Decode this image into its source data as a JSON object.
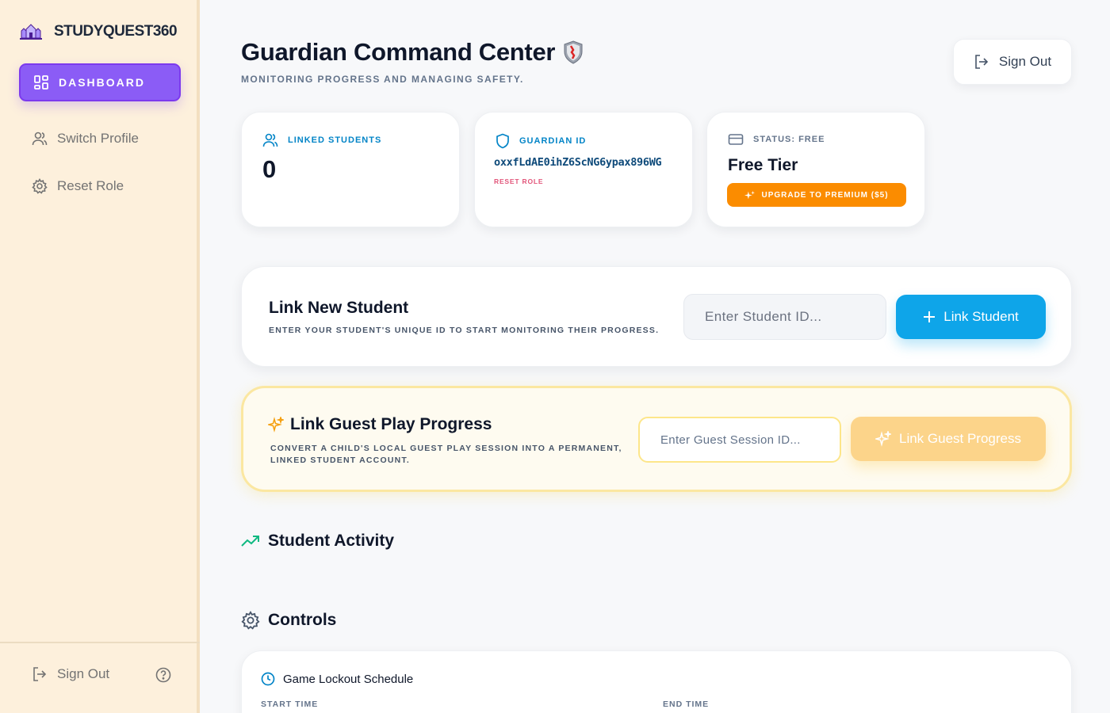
{
  "colors": {
    "accent_purple": "#8b5cf6",
    "accent_blue": "#0ea5e9",
    "accent_orange": "#fb8c00",
    "sidebar_bg": "#fdf0dc",
    "danger_pink": "#e2557a"
  },
  "sidebar": {
    "brand": "STUDYQUEST360",
    "items": [
      {
        "label": "DASHBOARD",
        "icon": "dashboard-grid-icon",
        "active": true
      },
      {
        "label": "Switch Profile",
        "icon": "users-icon"
      },
      {
        "label": "Reset Role",
        "icon": "gear-icon"
      }
    ],
    "signout_label": "Sign Out",
    "help_icon": "help-circle-icon"
  },
  "header": {
    "title": "Guardian Command Center",
    "title_icon": "shield-emoji-icon",
    "subtitle": "MONITORING PROGRESS AND MANAGING SAFETY.",
    "signout_label": "Sign Out"
  },
  "stats": {
    "linked": {
      "label": "LINKED STUDENTS",
      "value": "0"
    },
    "guardian": {
      "label": "GUARDIAN ID",
      "id": "oxxfLdAE0ihZ6ScNG6ypax896WG",
      "reset_label": "RESET ROLE"
    },
    "status": {
      "label": "STATUS: FREE",
      "tier": "Free Tier",
      "upgrade_label": "UPGRADE TO PREMIUM ($5)"
    }
  },
  "link_student": {
    "title": "Link New Student",
    "description": "ENTER YOUR STUDENT'S UNIQUE ID TO START MONITORING THEIR PROGRESS.",
    "placeholder": "Enter Student ID...",
    "button_label": "Link Student"
  },
  "guest": {
    "title": "Link Guest Play Progress",
    "description_line1": "CONVERT A CHILD'S LOCAL GUEST PLAY SESSION INTO A PERMANENT,",
    "description_line2": "LINKED STUDENT ACCOUNT.",
    "placeholder": "Enter Guest Session ID...",
    "button_label": "Link Guest Progress"
  },
  "sections": {
    "activity": "Student Activity",
    "controls": "Controls"
  },
  "controls": {
    "lockout_title": "Game Lockout Schedule",
    "start_label": "START TIME",
    "end_label": "END TIME"
  }
}
